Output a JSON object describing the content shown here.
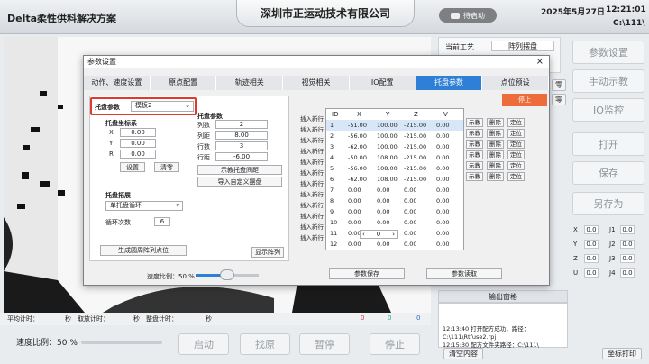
{
  "header": {
    "app_title": "Delta柔性供料解决方案",
    "company": "深圳市正运动技术有限公司",
    "mode_button": "待启动",
    "date": "2025年5月27日",
    "time": "12:21:01",
    "path": "C:\\111\\"
  },
  "status_bar": {
    "avg_time_label": "平均计时：",
    "avg_unit": "秒",
    "pick_label": "取放计时：",
    "pick_unit": "秒",
    "tray_label": "整盘计时：",
    "tray_unit": "秒",
    "count_a": "0",
    "count_b": "0",
    "count_c": "0"
  },
  "bottom": {
    "speed_label": "速度比例：",
    "speed_value": "50 %",
    "speed_fraction": 0.5,
    "start": "启动",
    "home": "找原",
    "pause": "暂停",
    "stop": "停止"
  },
  "right_panel": {
    "current_process_label": "当前工艺",
    "current_process_value": "阵列摆盘",
    "partial_btn_1": "零",
    "partial_btn_2": "零",
    "params_btn": "参数设置",
    "manual_btn": "手动示教",
    "io_btn": "IO监控",
    "open_btn": "打开",
    "save_btn": "保存",
    "saveas_btn": "另存为",
    "axes": [
      {
        "name": "X",
        "value": "0.0"
      },
      {
        "name": "J1",
        "value": "0.0"
      },
      {
        "name": "Y",
        "value": "0.0"
      },
      {
        "name": "J2",
        "value": "0.0"
      },
      {
        "name": "Z",
        "value": "0.0"
      },
      {
        "name": "J3",
        "value": "0.0"
      },
      {
        "name": "U",
        "value": "0.0"
      },
      {
        "name": "J4",
        "value": "0.0"
      }
    ],
    "output_title": "输出窗格",
    "log": [
      "12:13:40  打开配方成功，路径：C:\\111\\Rtfuse2.rpj",
      "12:15:30  配方文件夹路径：C:\\111\\"
    ],
    "clear_btn": "清空内容",
    "print_btn": "坐标打印"
  },
  "modal": {
    "title": "参数设置",
    "close": "×",
    "tabs": [
      "动作、速度设置",
      "原点配置",
      "轨迹相关",
      "视觉相关",
      "IO配置",
      "托盘参数",
      "点位预设"
    ],
    "active_tab": 5,
    "stop_btn": "停止",
    "tray_param_label": "托盘参数",
    "tray_template": "模板2",
    "tray_coord_title": "托盘坐标系",
    "coord_x_label": "X",
    "coord_x": "0.00",
    "coord_y_label": "Y",
    "coord_y": "0.00",
    "coord_r_label": "R",
    "coord_r": "0.00",
    "set_btn": "设置",
    "clear_btn": "清零",
    "expand_title": "托盘拓展",
    "expand_mode": "单托盘循环",
    "loop_label": "循环次数",
    "loop_value": "6",
    "gen_btn": "生成圆周阵列点位",
    "tray_params_title": "托盘参数",
    "cols_label": "列数",
    "cols_value": "2",
    "col_gap_label": "列距",
    "col_gap_value": "8.00",
    "rows_label": "行数",
    "rows_value": "3",
    "row_gap_label": "行距",
    "row_gap_value": "-6.00",
    "teach_btn": "示教托盘间距",
    "import_btn": "导入自定义摆盘",
    "show_btn": "显示阵列",
    "speed_label": "速度比例：",
    "speed_value": "50 %",
    "speed_fraction": 0.5,
    "save_btn": "参数保存",
    "read_btn": "参数读取",
    "insert_label": "插入新行",
    "grid_headers": [
      "ID",
      "X",
      "Y",
      "Z",
      "V"
    ],
    "rows": [
      {
        "id": "1",
        "x": "-51.00",
        "y": "100.00",
        "z": "-215.00",
        "v": "0.00"
      },
      {
        "id": "2",
        "x": "-56.00",
        "y": "100.00",
        "z": "-215.00",
        "v": "0.00"
      },
      {
        "id": "3",
        "x": "-62.00",
        "y": "100.00",
        "z": "-215.00",
        "v": "0.00"
      },
      {
        "id": "4",
        "x": "-50.00",
        "y": "108.00",
        "z": "-215.00",
        "v": "0.00"
      },
      {
        "id": "5",
        "x": "-56.00",
        "y": "108.00",
        "z": "-215.00",
        "v": "0.00"
      },
      {
        "id": "6",
        "x": "-62.00",
        "y": "108.00",
        "z": "-215.00",
        "v": "0.00"
      },
      {
        "id": "7",
        "x": "0.00",
        "y": "0.00",
        "z": "0.00",
        "v": "0.00"
      },
      {
        "id": "8",
        "x": "0.00",
        "y": "0.00",
        "z": "0.00",
        "v": "0.00"
      },
      {
        "id": "9",
        "x": "0.00",
        "y": "0.00",
        "z": "0.00",
        "v": "0.00"
      },
      {
        "id": "10",
        "x": "0.00",
        "y": "0.00",
        "z": "0.00",
        "v": "0.00"
      },
      {
        "id": "11",
        "x": "0.00",
        "y": "0.00",
        "z": "0.00",
        "v": "0.00"
      },
      {
        "id": "12",
        "x": "0.00",
        "y": "0.00",
        "z": "0.00",
        "v": "0.00"
      }
    ],
    "row_btn_teach": "示教",
    "row_btn_delete": "删除",
    "row_btn_locate": "定位",
    "page_value": "0"
  }
}
